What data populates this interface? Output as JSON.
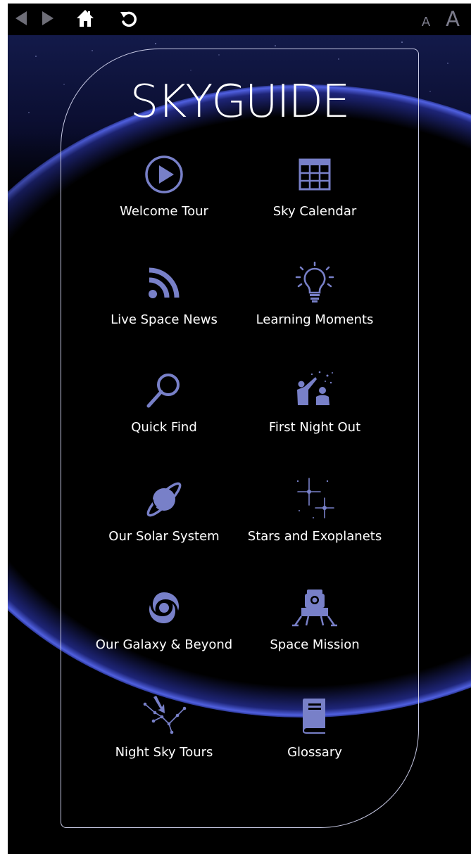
{
  "toolbar": {
    "back_icon": "triangle-left",
    "forward_icon": "triangle-right",
    "home_icon": "house",
    "refresh_icon": "circular-arrow",
    "font_small_label": "A",
    "font_large_label": "A"
  },
  "title": "SKYGUIDE",
  "colors": {
    "accent": "#7880c8",
    "background": "#000000",
    "planet_glow": "#3a44b8",
    "text": "#ffffff"
  },
  "menu": [
    {
      "label": "Welcome Tour",
      "icon": "play-circle-icon"
    },
    {
      "label": "Sky Calendar",
      "icon": "calendar-grid-icon"
    },
    {
      "label": "Live Space News",
      "icon": "rss-feed-icon"
    },
    {
      "label": "Learning Moments",
      "icon": "lightbulb-icon"
    },
    {
      "label": "Quick Find",
      "icon": "magnifier-icon"
    },
    {
      "label": "First Night Out",
      "icon": "stargazers-icon"
    },
    {
      "label": "Our Solar System",
      "icon": "ringed-planet-icon"
    },
    {
      "label": "Stars and Exoplanets",
      "icon": "sparkling-stars-icon"
    },
    {
      "label": "Our Galaxy & Beyond",
      "icon": "spiral-galaxy-icon"
    },
    {
      "label": "Space Mission",
      "icon": "lunar-lander-icon"
    },
    {
      "label": "Night Sky Tours",
      "icon": "constellation-pointer-icon"
    },
    {
      "label": "Glossary",
      "icon": "book-icon"
    }
  ]
}
